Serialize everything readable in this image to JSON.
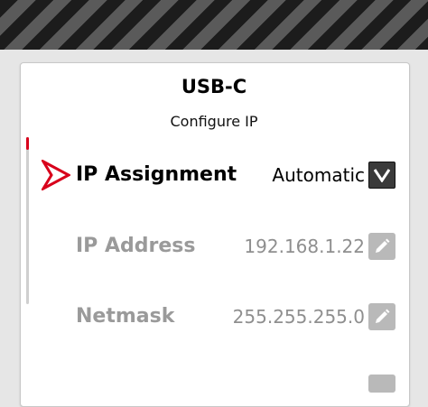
{
  "panel": {
    "title": "USB-C",
    "subtitle": "Configure IP"
  },
  "settings": [
    {
      "label": "IP Assignment",
      "value": "Automatic",
      "control": "dropdown",
      "selected": true
    },
    {
      "label": "IP Address",
      "value": "192.168.1.22",
      "control": "edit",
      "selected": false
    },
    {
      "label": "Netmask",
      "value": "255.255.255.0",
      "control": "edit",
      "selected": false
    }
  ],
  "colors": {
    "accent": "#d8001b",
    "disabled_text": "#9a9a9a",
    "edit_button": "#b9b9b9",
    "dropdown_button": "#3a3a3a"
  },
  "icons": {
    "selection_pointer": "arrow-pointer-icon",
    "dropdown": "chevron-down-icon",
    "edit": "pencil-icon"
  }
}
